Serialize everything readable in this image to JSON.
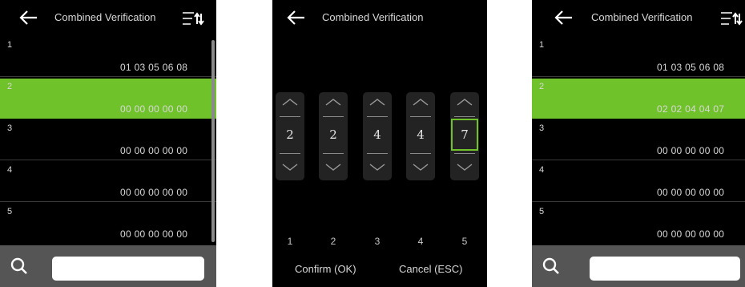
{
  "colors": {
    "selected_row": "#70c22a",
    "background": "#000000",
    "search_bar": "#555555"
  },
  "screens": [
    {
      "title": "Combined Verification",
      "rows": [
        {
          "number": "1",
          "value": "01 03 05 06 08"
        },
        {
          "number": "2",
          "value": "00 00 00 00 00",
          "selected": true
        },
        {
          "number": "3",
          "value": "00 00 00 00 00"
        },
        {
          "number": "4",
          "value": "00 00 00 00 00"
        },
        {
          "number": "5",
          "value": "00 00 00 00 00"
        }
      ],
      "search": {
        "value": "",
        "placeholder": ""
      }
    },
    {
      "title": "Combined Verification",
      "digits": [
        "2",
        "2",
        "4",
        "4",
        "7"
      ],
      "focused_column": 5,
      "column_labels": [
        "1",
        "2",
        "3",
        "4",
        "5"
      ],
      "confirm_label": "Confirm (OK)",
      "cancel_label": "Cancel (ESC)"
    },
    {
      "title": "Combined Verification",
      "rows": [
        {
          "number": "1",
          "value": "01 03 05 06 08"
        },
        {
          "number": "2",
          "value": "02 02 04 04 07",
          "selected": true
        },
        {
          "number": "3",
          "value": "00 00 00 00 00"
        },
        {
          "number": "4",
          "value": "00 00 00 00 00"
        },
        {
          "number": "5",
          "value": "00 00 00 00 00"
        }
      ],
      "search": {
        "value": "",
        "placeholder": ""
      }
    }
  ],
  "icons": {
    "back": "back-arrow-icon",
    "sort": "sort-icon",
    "search": "search-icon"
  }
}
